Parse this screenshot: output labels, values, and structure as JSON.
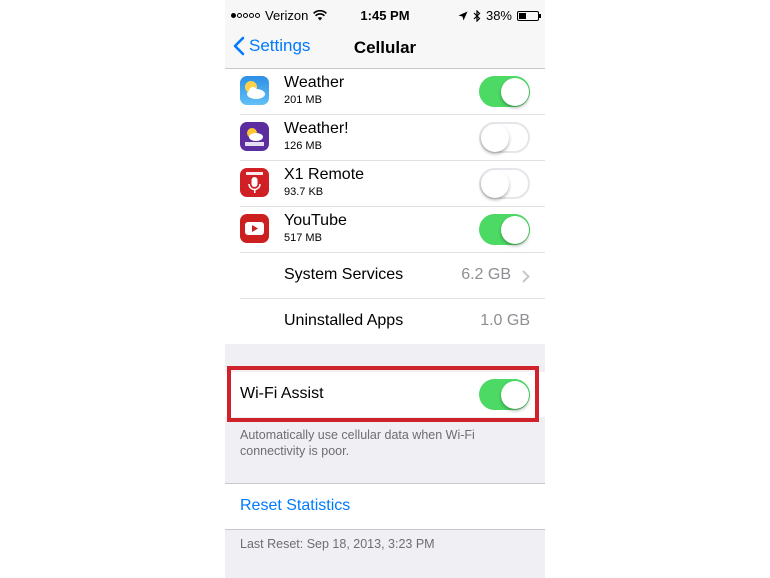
{
  "status_bar": {
    "carrier": "Verizon",
    "time": "1:45 PM",
    "battery": "38%",
    "signal_bars_filled": 1,
    "signal_bars_total": 5,
    "battery_level": 0.38
  },
  "nav": {
    "back_label": "Settings",
    "title": "Cellular"
  },
  "apps": [
    {
      "name": "Weather",
      "size": "201 MB",
      "enabled": true,
      "icon": "weather-app-icon",
      "color": "#3a9be0"
    },
    {
      "name": "Weather!",
      "size": "126 MB",
      "enabled": false,
      "icon": "yahoo-weather-app-icon",
      "color": "#5b2d9e"
    },
    {
      "name": "X1 Remote",
      "size": "93.7 KB",
      "enabled": false,
      "icon": "xfinity-remote-app-icon",
      "color": "#d11f26"
    },
    {
      "name": "YouTube",
      "size": "517 MB",
      "enabled": true,
      "icon": "youtube-app-icon",
      "color": "#cc1f1f"
    }
  ],
  "system_services": {
    "label": "System Services",
    "value": "6.2 GB"
  },
  "uninstalled_apps": {
    "label": "Uninstalled Apps",
    "value": "1.0 GB"
  },
  "wifi_assist": {
    "label": "Wi-Fi Assist",
    "enabled": true,
    "description": "Automatically use cellular data when Wi-Fi connectivity is poor."
  },
  "reset": {
    "label": "Reset Statistics",
    "last_reset": "Last Reset: Sep 18, 2013, 3:23 PM"
  },
  "colors": {
    "accent": "#007aff",
    "toggle_on": "#4cd964",
    "highlight": "#d0222a"
  }
}
